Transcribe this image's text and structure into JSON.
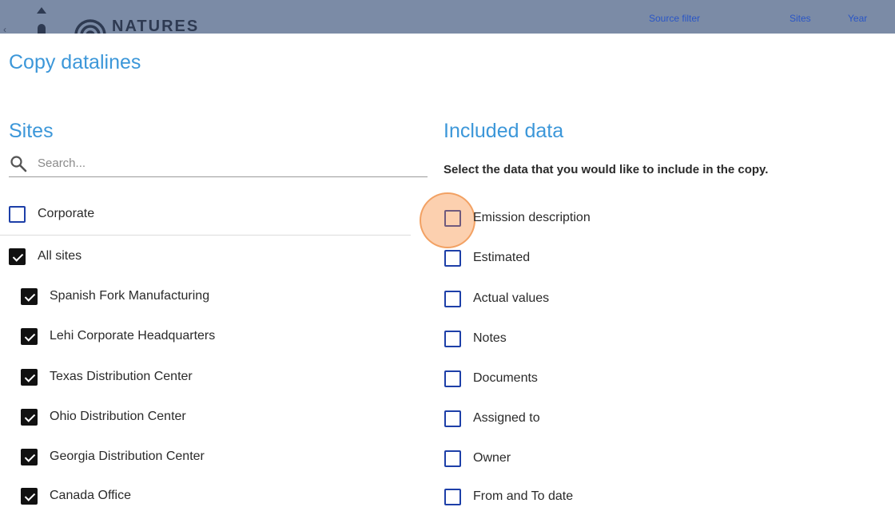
{
  "header": {
    "logo_text": "NATURES",
    "nav": [
      "Source filter",
      "Sites",
      "Year"
    ]
  },
  "page_title": "Copy datalines",
  "sites": {
    "title": "Sites",
    "search_placeholder": "Search...",
    "corporate": {
      "label": "Corporate",
      "checked": false
    },
    "all_sites": {
      "label": "All sites",
      "checked": true
    },
    "items": [
      {
        "label": "Spanish Fork Manufacturing",
        "checked": true
      },
      {
        "label": "Lehi Corporate Headquarters",
        "checked": true
      },
      {
        "label": "Texas Distribution Center",
        "checked": true
      },
      {
        "label": "Ohio Distribution Center",
        "checked": true
      },
      {
        "label": "Georgia Distribution Center",
        "checked": true
      },
      {
        "label": "Canada Office",
        "checked": true
      }
    ]
  },
  "included": {
    "title": "Included data",
    "instructions": "Select the data that you would like to include in the copy.",
    "items": [
      {
        "label": "Emission description",
        "checked": false
      },
      {
        "label": "Estimated",
        "checked": false
      },
      {
        "label": "Actual values",
        "checked": false
      },
      {
        "label": "Notes",
        "checked": false
      },
      {
        "label": "Documents",
        "checked": false
      },
      {
        "label": "Assigned to",
        "checked": false
      },
      {
        "label": "Owner",
        "checked": false
      },
      {
        "label": "From and To date",
        "checked": false
      }
    ]
  },
  "colors": {
    "accent": "#3c97d9",
    "checkbox_border": "#1d3fa8",
    "header_bg": "#7b8ba6",
    "click_highlight": "#f7a66a"
  }
}
